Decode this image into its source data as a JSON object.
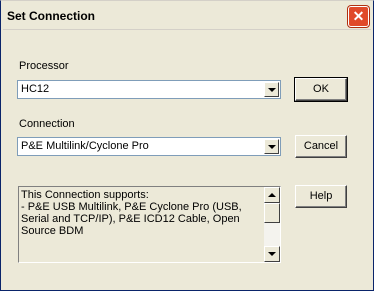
{
  "window": {
    "title": "Set Connection",
    "close_icon": "close-x-icon"
  },
  "processor": {
    "label": "Processor",
    "selected": "HC12"
  },
  "connection": {
    "label": "Connection",
    "selected": "P&E Multilink/Cyclone Pro"
  },
  "buttons": {
    "ok": "OK",
    "cancel": "Cancel",
    "help": "Help"
  },
  "supports_text": "This Connection supports:\n- P&E USB Multilink, P&E Cyclone Pro (USB, Serial and TCP/IP), P&E ICD12 Cable, Open Source BDM"
}
